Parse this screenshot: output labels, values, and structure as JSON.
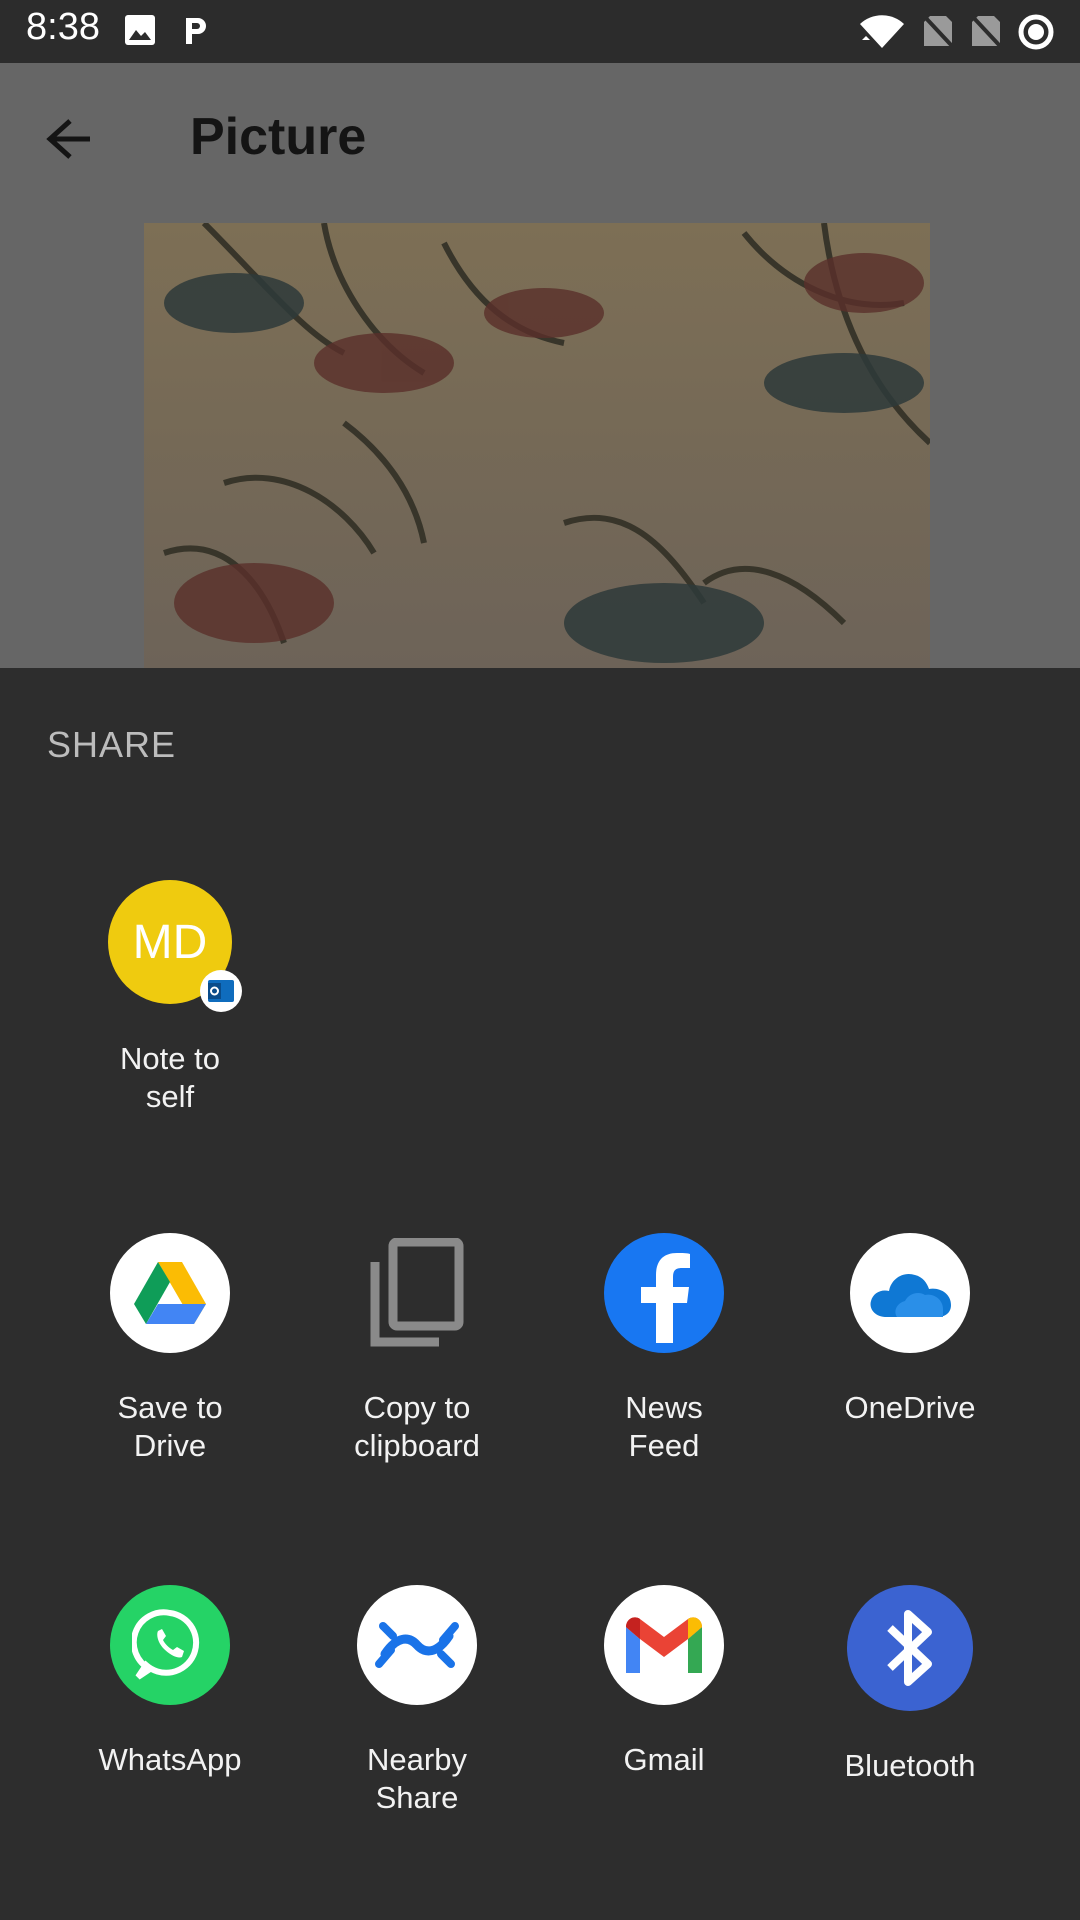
{
  "status_bar": {
    "time": "8:38",
    "icons": [
      "image-icon",
      "p-app-icon",
      "wifi-icon",
      "no-sim-icon",
      "no-sim-icon",
      "record-icon"
    ]
  },
  "app": {
    "title": "Picture",
    "back_icon": "arrow-left-icon"
  },
  "share": {
    "heading": "SHARE",
    "direct_share": [
      {
        "label": "Note to\nself",
        "avatar_text": "MD",
        "color": "#efcb0f",
        "badge": "outlook-icon"
      }
    ],
    "apps_row1": [
      {
        "label": "Save to\nDrive",
        "icon": "google-drive-icon"
      },
      {
        "label": "Copy to\nclipboard",
        "icon": "copy-icon"
      },
      {
        "label": "News\nFeed",
        "icon": "facebook-icon"
      },
      {
        "label": "OneDrive",
        "icon": "onedrive-icon"
      }
    ],
    "apps_row2": [
      {
        "label": "WhatsApp",
        "icon": "whatsapp-icon"
      },
      {
        "label": "Nearby\nShare",
        "icon": "nearby-share-icon"
      },
      {
        "label": "Gmail",
        "icon": "gmail-icon"
      },
      {
        "label": "Bluetooth",
        "icon": "bluetooth-icon"
      }
    ]
  },
  "colors": {
    "sheet_bg": "#2d2d2d",
    "dim_overlay": "#666666",
    "avatar_yellow": "#efcb0f",
    "facebook_blue": "#1877f2",
    "whatsapp_green": "#25d366",
    "bluetooth_blue": "#3b63d1"
  }
}
